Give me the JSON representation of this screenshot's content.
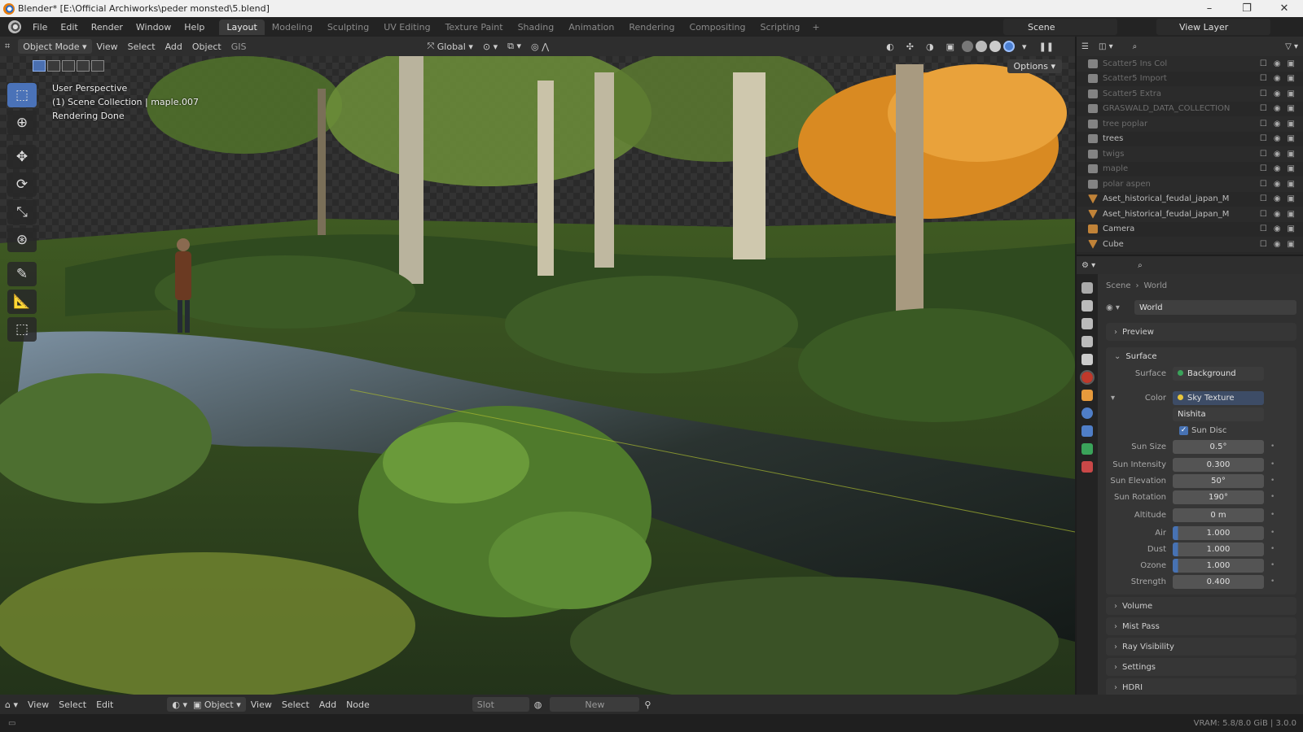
{
  "window": {
    "title": "Blender* [E:\\Official Archiworks\\peder monsted\\5.blend]",
    "controls": [
      "–",
      "❐",
      "✕"
    ]
  },
  "menu": {
    "items": [
      "File",
      "Edit",
      "Render",
      "Window",
      "Help"
    ],
    "workspaces": [
      "Layout",
      "Modeling",
      "Sculpting",
      "UV Editing",
      "Texture Paint",
      "Shading",
      "Animation",
      "Rendering",
      "Compositing",
      "Scripting"
    ],
    "active_workspace": "Layout",
    "add_workspace": "+",
    "scene": "Scene",
    "view_layer": "View Layer"
  },
  "viewport_header": {
    "mode": "Object Mode",
    "menus": [
      "View",
      "Select",
      "Add",
      "Object",
      "GIS"
    ],
    "transform_orientation": "Global",
    "options": "Options"
  },
  "viewport": {
    "overlay_lines": [
      "User Perspective",
      "(1) Scene Collection | maple.007",
      "Rendering Done"
    ]
  },
  "outliner": {
    "rows": [
      {
        "label": "Scatter5 Ins Col",
        "dim": true,
        "type": "col"
      },
      {
        "label": "Scatter5 Import",
        "dim": true,
        "type": "col"
      },
      {
        "label": "Scatter5 Extra",
        "dim": true,
        "type": "col"
      },
      {
        "label": "GRASWALD_DATA_COLLECTION",
        "dim": true,
        "type": "col"
      },
      {
        "label": "tree poplar",
        "dim": true,
        "type": "col"
      },
      {
        "label": "trees",
        "dim": false,
        "type": "col"
      },
      {
        "label": "twigs",
        "dim": true,
        "type": "col"
      },
      {
        "label": "maple",
        "dim": true,
        "type": "col"
      },
      {
        "label": "polar aspen",
        "dim": true,
        "type": "col"
      },
      {
        "label": "Aset_historical_feudal_japan_M",
        "dim": false,
        "type": "obj"
      },
      {
        "label": "Aset_historical_feudal_japan_M",
        "dim": false,
        "type": "obj"
      },
      {
        "label": "Camera",
        "dim": false,
        "type": "cam"
      },
      {
        "label": "Cube",
        "dim": false,
        "type": "obj"
      }
    ]
  },
  "properties": {
    "breadcrumb": [
      "Scene",
      "›",
      "World"
    ],
    "world_name": "World",
    "panels": {
      "preview": "Preview",
      "surface": "Surface"
    },
    "surface": {
      "surface_label": "Surface",
      "surface_value": "Background",
      "color_label": "Color",
      "color_value": "Sky Texture",
      "sky_type": "Nishita",
      "sun_disc_label": "Sun Disc",
      "rows": [
        {
          "label": "Sun Size",
          "value": "0.5°"
        },
        {
          "label": "Sun Intensity",
          "value": "0.300"
        },
        {
          "label": "Sun Elevation",
          "value": "50°"
        },
        {
          "label": "Sun Rotation",
          "value": "190°"
        },
        {
          "label": "Altitude",
          "value": "0 m"
        },
        {
          "label": "Air",
          "value": "1.000"
        },
        {
          "label": "Dust",
          "value": "1.000"
        },
        {
          "label": "Ozone",
          "value": "1.000"
        },
        {
          "label": "Strength",
          "value": "0.400"
        }
      ]
    },
    "collapsed_panels": [
      "Volume",
      "Mist Pass",
      "Ray Visibility",
      "Settings",
      "HDRI"
    ]
  },
  "bottom_bar": {
    "menus": [
      "View",
      "Select",
      "Edit"
    ],
    "object_label": "Object",
    "menus2": [
      "View",
      "Select",
      "Add",
      "Node"
    ],
    "slot": "Slot",
    "new": "New"
  },
  "status": {
    "vram": "VRAM: 5.8/8.0 GiB | 3.0.0"
  },
  "colors": {
    "accent": "#4772b3",
    "orange": "#e79a3c"
  }
}
